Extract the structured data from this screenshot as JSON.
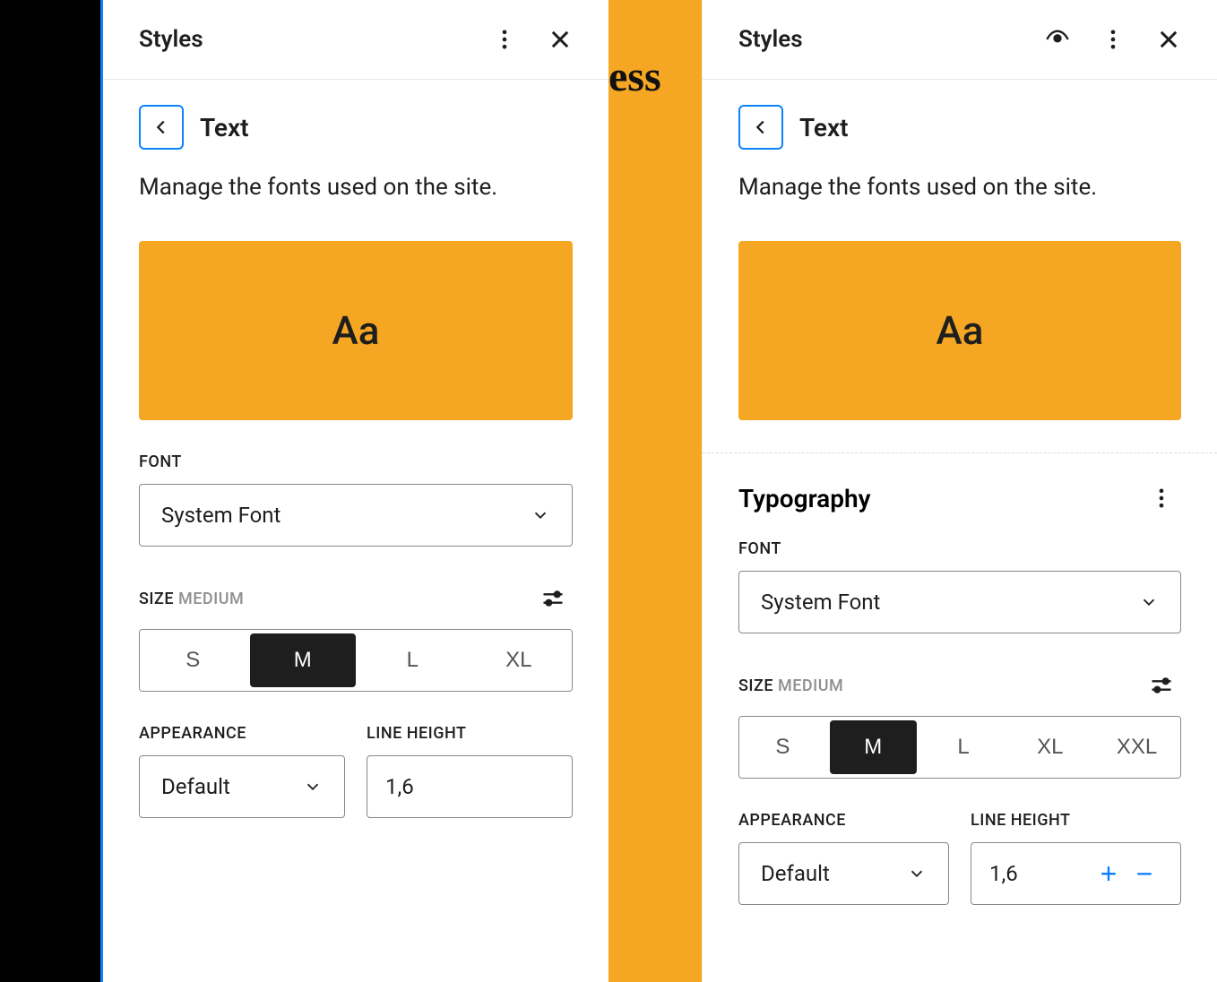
{
  "left": {
    "header_title": "Styles",
    "crumb": "Text",
    "subtitle": "Manage the fonts used on the site.",
    "preview": "Aa",
    "font_label": "FONT",
    "font_value": "System Font",
    "size_label": "SIZE",
    "size_value_label": "MEDIUM",
    "sizes": [
      "S",
      "M",
      "L",
      "XL"
    ],
    "size_active": "M",
    "appearance_label": "APPEARANCE",
    "appearance_value": "Default",
    "lineheight_label": "LINE HEIGHT",
    "lineheight_value": "1,6"
  },
  "right": {
    "header_title": "Styles",
    "crumb": "Text",
    "subtitle": "Manage the fonts used on the site.",
    "preview": "Aa",
    "typography_heading": "Typography",
    "font_label": "FONT",
    "font_value": "System Font",
    "size_label": "SIZE",
    "size_value_label": "MEDIUM",
    "sizes": [
      "S",
      "M",
      "L",
      "XL",
      "XXL"
    ],
    "size_active": "M",
    "appearance_label": "APPEARANCE",
    "appearance_value": "Default",
    "lineheight_label": "LINE HEIGHT",
    "lineheight_value": "1,6"
  },
  "peek_text": "ess",
  "colors": {
    "accent": "#f5a623",
    "focus": "#0a84ff"
  }
}
